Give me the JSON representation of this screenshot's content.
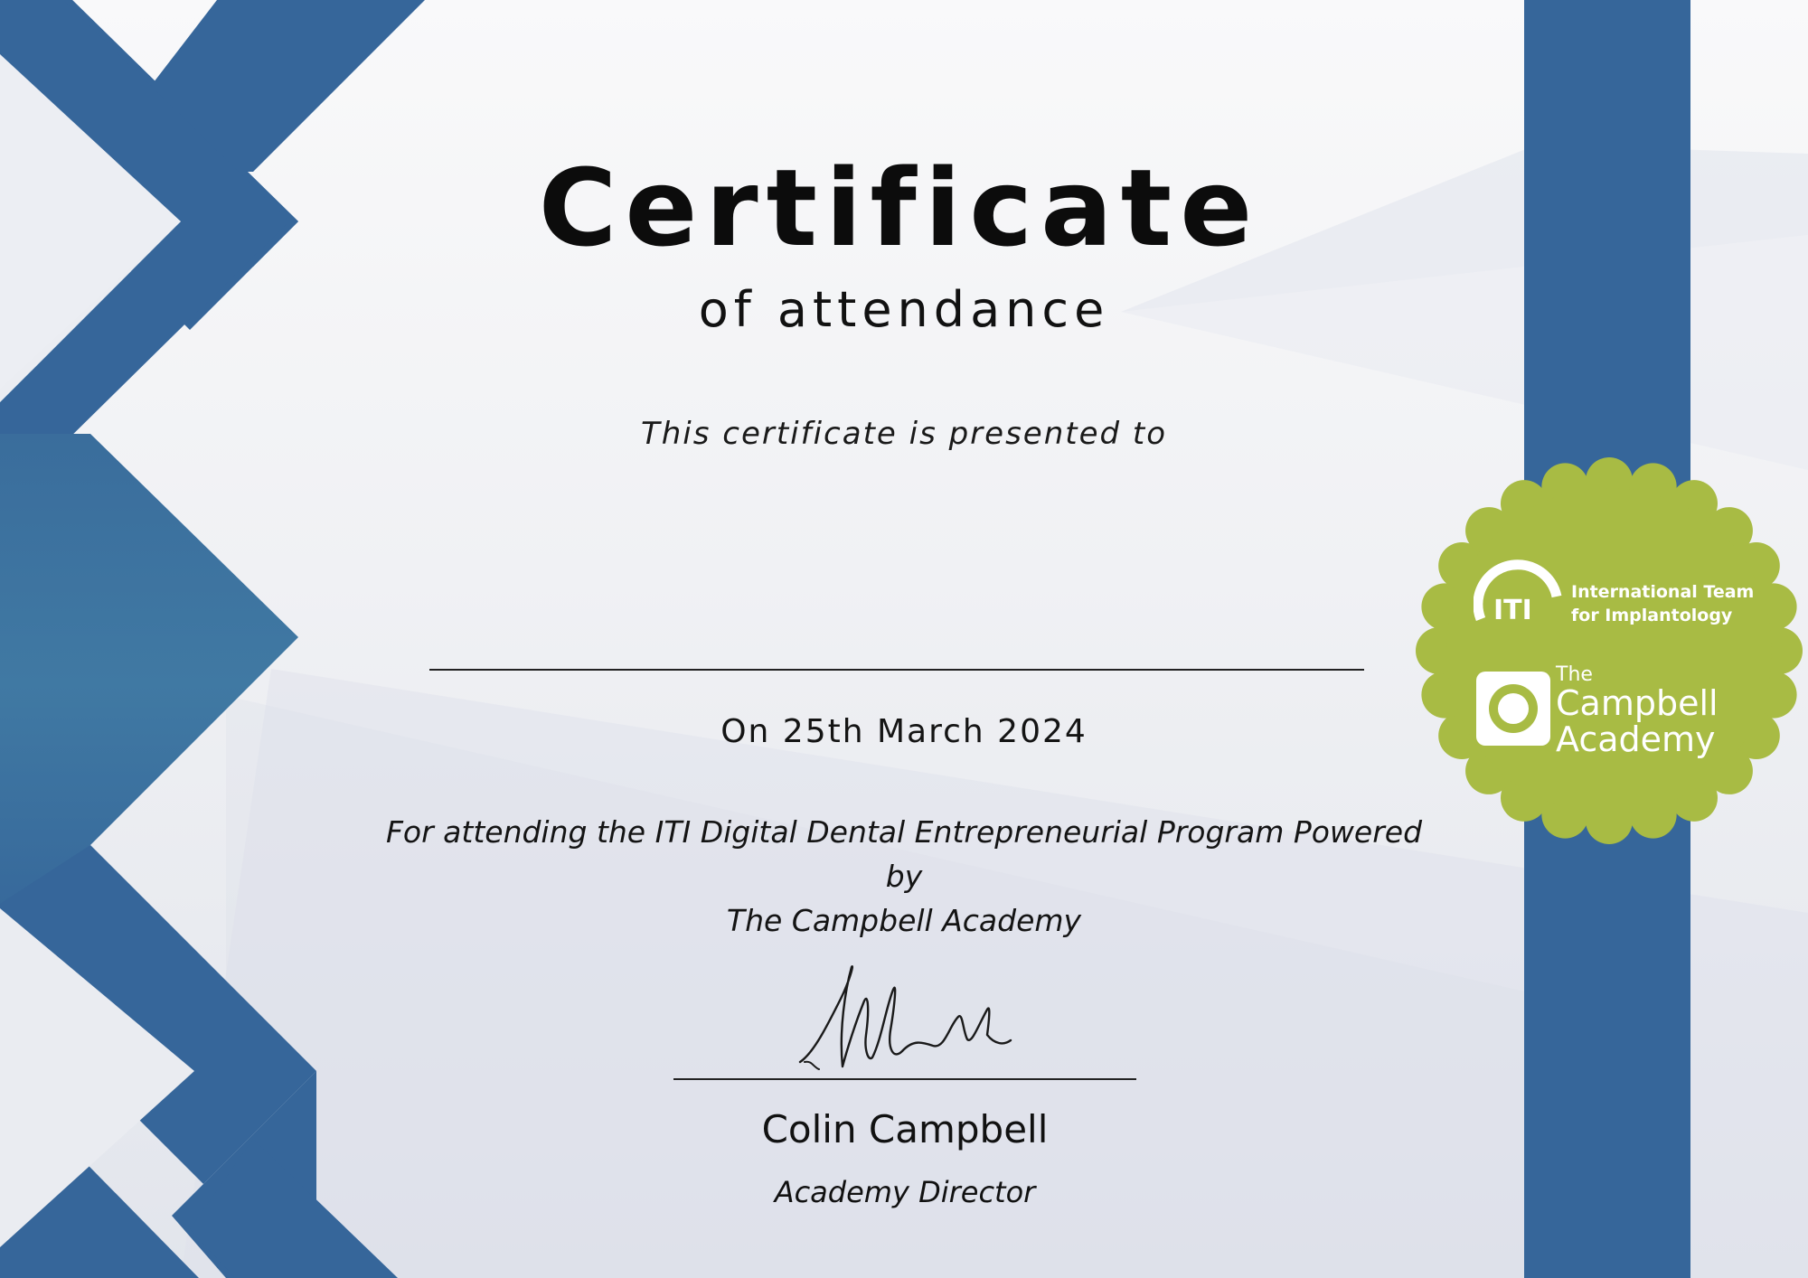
{
  "certificate": {
    "title": "Certificate",
    "subtitle": "of attendance",
    "presented_text": "This certificate is presented to",
    "recipient_name": "",
    "date_text": "On 25th March 2024",
    "reason_line1": "For attending the ITI Digital Dental Entrepreneurial Program Powered by",
    "reason_line2": "The Campbell Academy"
  },
  "signature": {
    "signer_name": "Colin Campbell",
    "signer_role": "Academy Director"
  },
  "badge": {
    "iti_mark": "ITI",
    "iti_name_line1": "International Team",
    "iti_name_line2": "for Implantology",
    "academy_the": "The",
    "academy_line1": "Campbell",
    "academy_line2": "Academy"
  },
  "colors": {
    "navy_blue": "#36669a",
    "badge_green": "#a8bb44",
    "background": "#f0f1f4",
    "text": "#111111"
  }
}
